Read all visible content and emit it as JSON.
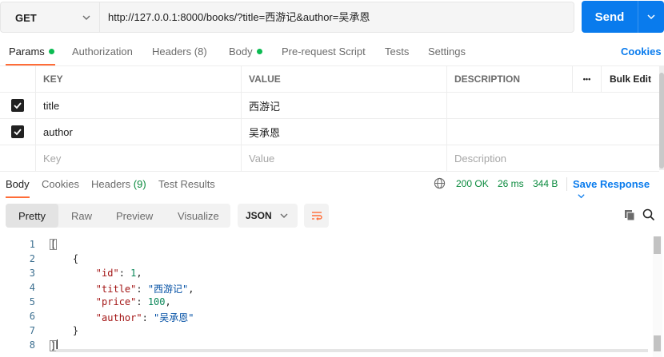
{
  "request": {
    "method": "GET",
    "url": "http://127.0.0.1:8000/books/?title=西游记&author=吴承恩",
    "send_label": "Send"
  },
  "request_tabs": [
    {
      "label": "Params",
      "active": true,
      "dot": true
    },
    {
      "label": "Authorization"
    },
    {
      "label": "Headers",
      "count": "(8)"
    },
    {
      "label": "Body",
      "dot": true
    },
    {
      "label": "Pre-request Script"
    },
    {
      "label": "Tests"
    },
    {
      "label": "Settings"
    }
  ],
  "cookies_label": "Cookies",
  "params": {
    "headers": {
      "key": "KEY",
      "value": "VALUE",
      "description": "DESCRIPTION",
      "more": "•••",
      "bulk_edit": "Bulk Edit"
    },
    "rows": [
      {
        "key": "title",
        "value": "西游记",
        "checked": true
      },
      {
        "key": "author",
        "value": "吴承恩",
        "checked": true
      }
    ],
    "placeholders": {
      "key": "Key",
      "value": "Value",
      "description": "Description"
    }
  },
  "response_tabs": [
    {
      "label": "Body",
      "active": true
    },
    {
      "label": "Cookies"
    },
    {
      "label": "Headers",
      "count": "(9)"
    },
    {
      "label": "Test Results"
    }
  ],
  "response_meta": {
    "status": "200 OK",
    "time": "26 ms",
    "size": "344 B",
    "save_label": "Save Response"
  },
  "format_tabs": [
    "Pretty",
    "Raw",
    "Preview",
    "Visualize"
  ],
  "format_select": "JSON",
  "code": {
    "line_numbers": [
      "1",
      "2",
      "3",
      "4",
      "5",
      "6",
      "7",
      "8"
    ],
    "id_key": "\"id\"",
    "id_val": "1",
    "title_key": "\"title\"",
    "title_val": "\"西游记\"",
    "price_key": "\"price\"",
    "price_val": "100",
    "author_key": "\"author\"",
    "author_val": "\"吴承恩\""
  },
  "colors": {
    "accent": "#097bed",
    "tab_underline": "#ff6c37",
    "status": "#0a8a3d"
  }
}
